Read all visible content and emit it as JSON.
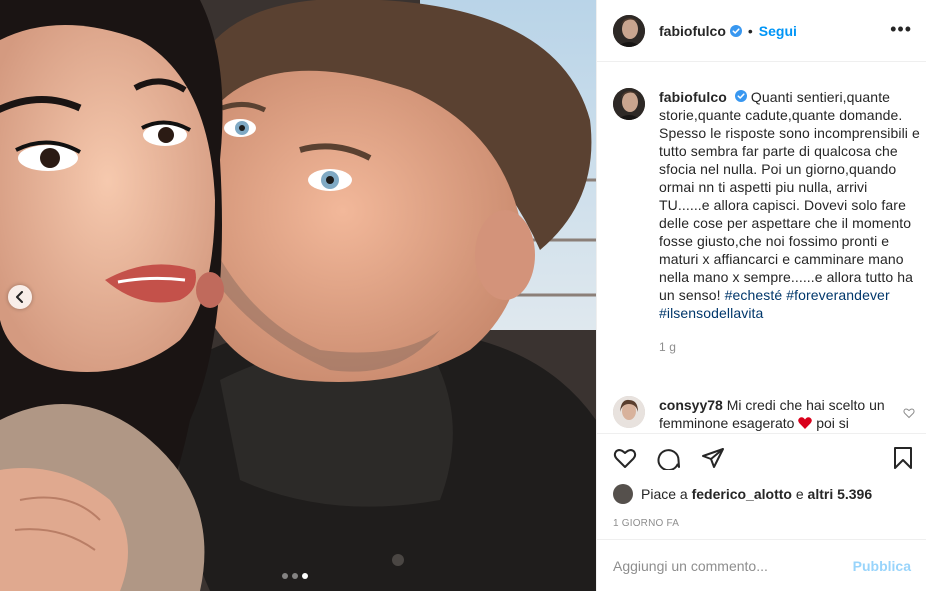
{
  "photo": {
    "alt": "",
    "carousel_dots": 3,
    "active_dot": 3
  },
  "header": {
    "username": "fabiofulco",
    "separator": "•",
    "follow_label": "Segui",
    "more_label": "•••"
  },
  "caption": {
    "username": "fabiofulco",
    "text": "Quanti sentieri,quante storie,quante cadute,quante domande. Spesso le risposte sono incomprensibili e tutto sembra far parte di qualcosa che sfocia nel nulla. Poi un giorno,quando ormai nn ti aspetti piu nulla, arrivi TU......e allora capisci. Dovevi solo fare delle cose per aspettare che il momento fosse giusto,che noi fossimo pronti e maturi x affiancarci e camminare mano nella mano x sempre......e allora tutto ha un senso!",
    "hashtags": [
      "#echesté",
      "#foreverandever",
      "#ilsensodellavita"
    ],
    "time": "1 g"
  },
  "comments": [
    {
      "username": "consyy78",
      "text_before": "Mi credi che hai scelto un femminone esagerato",
      "emoji": "❤️",
      "text_after": "poi si"
    }
  ],
  "likes": {
    "prefix": "Piace a",
    "user": "federico_alotto",
    "connector": "e",
    "others": "altri 5.396"
  },
  "date": "1 giorno fa",
  "comment_input": {
    "placeholder": "Aggiungi un commento...",
    "post_label": "Pubblica"
  },
  "colors": {
    "accent": "#0095f6",
    "hashtag": "#00376b",
    "muted": "#8e8e8e",
    "text": "#262626",
    "border": "#efefef"
  }
}
